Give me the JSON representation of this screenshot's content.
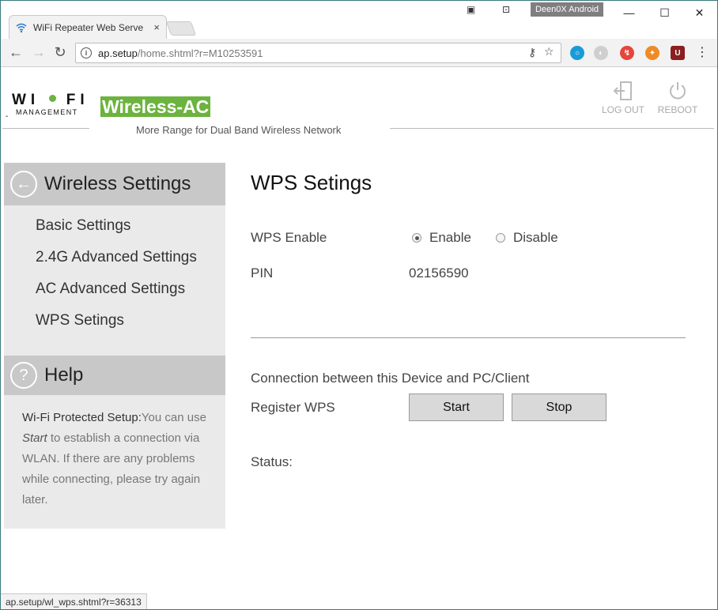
{
  "browser": {
    "tab_title": "WiFi Repeater Web Serve",
    "tab_close": "×",
    "profile_name": "Deen0X Android",
    "window_controls": {
      "minimize": "—",
      "maximize": "☐",
      "close": "✕"
    },
    "url_host": "ap.setup",
    "url_path": "/home.shtml?r=M10253591",
    "info_icon": "i",
    "back": "←",
    "forward": "→",
    "reload": "↻",
    "menu": "⋮",
    "status_url": "ap.setup/wl_wps.shtml?r=36313"
  },
  "header": {
    "logo_text": "WI  FI",
    "logo_sub": "MANAGEMENT",
    "logo_dash": "-",
    "brand": "Wireless-AC",
    "tagline": "More Range for Dual Band Wireless Network",
    "logout_label": "LOG OUT",
    "reboot_label": "REBOOT"
  },
  "sidebar": {
    "title": "Wireless Settings",
    "items": [
      {
        "label": "Basic Settings"
      },
      {
        "label": "2.4G Advanced Settings"
      },
      {
        "label": "AC Advanced Settings"
      },
      {
        "label": "WPS Setings"
      }
    ],
    "help_title": "Help",
    "help_bold": "Wi-Fi Protected Setup:",
    "help_pre": "You can use ",
    "help_italic": "Start",
    "help_post": " to establish a connection via WLAN. If there are any problems while connecting, please try again later."
  },
  "main": {
    "title": "WPS Setings",
    "wps_enable_label": "WPS Enable",
    "enable_label": "Enable",
    "disable_label": "Disable",
    "wps_enabled": true,
    "pin_label": "PIN",
    "pin_value": "02156590",
    "connection_text": "Connection between this Device and PC/Client",
    "register_label": "Register WPS",
    "start_label": "Start",
    "stop_label": "Stop",
    "status_label": "Status:"
  },
  "colors": {
    "brand_green": "#6cb33f",
    "sidebar_bg": "#eaeaea",
    "sidebar_head": "#c8c8c8"
  }
}
